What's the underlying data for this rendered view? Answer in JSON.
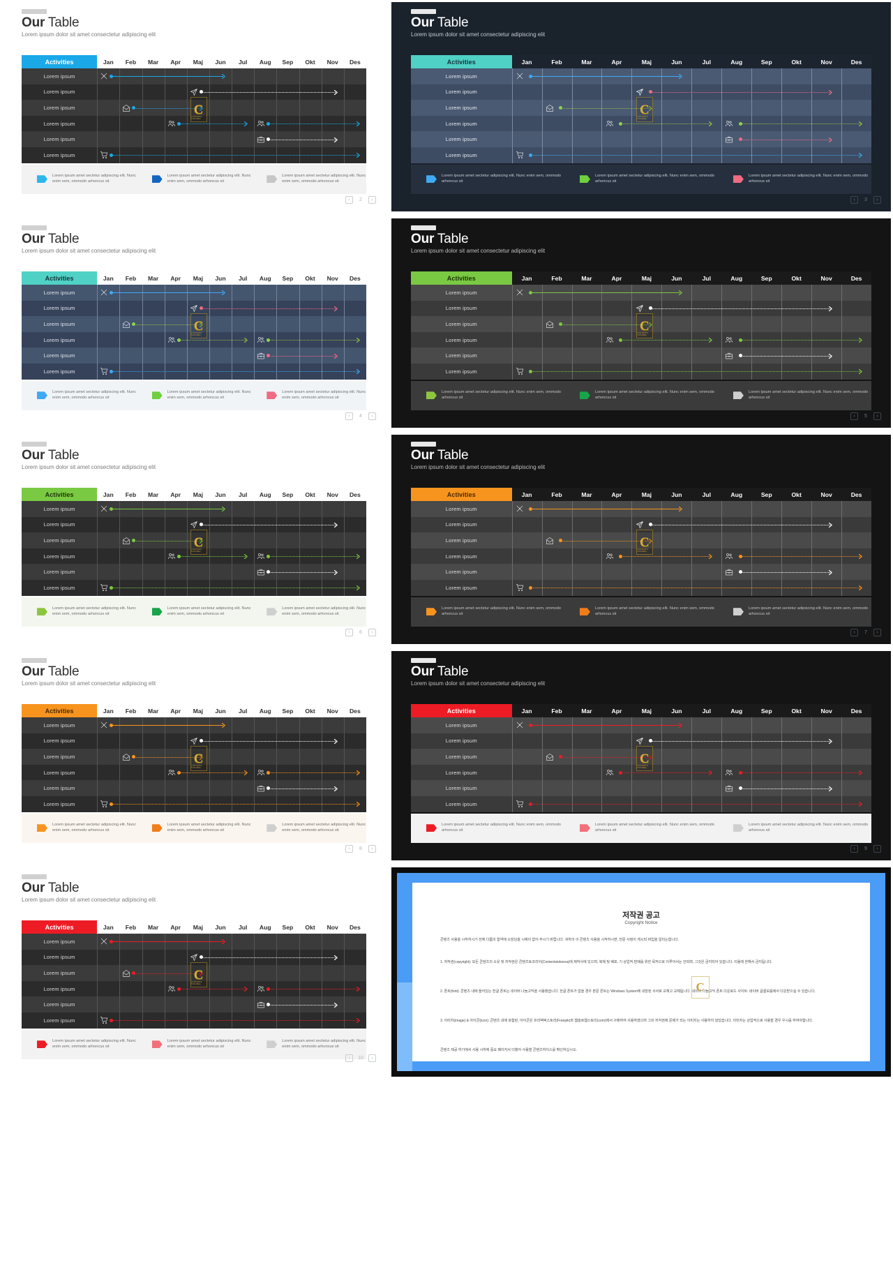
{
  "common": {
    "title_bold": "Our",
    "title_rest": " Table",
    "subtitle": "Lorem ipsum dolor sit amet consectetur adipiscing elit",
    "activities_header": "Activities",
    "months": [
      "Jan",
      "Feb",
      "Mar",
      "Apr",
      "Maj",
      "Jun",
      "Jul",
      "Aug",
      "Sep",
      "Okt",
      "Nov",
      "Des"
    ],
    "rows": [
      "Lorem ipsum",
      "Lorem ipsum",
      "Lorem ipsum",
      "Lorem ipsum",
      "Lorem ipsum",
      "Lorem ipsum"
    ],
    "row_icons": [
      "tools-icon",
      "paper-plane-icon",
      "mail-open-icon",
      "users-icon",
      "briefcase-icon",
      "shopping-cart-icon"
    ],
    "legend_text": "Lorem ipsum amet sectetur adipiscing elit. Nunc enim sem, ommodo arhoncus sit",
    "watermark_letter": "C",
    "watermark_sub": "CONTENTS TOKOREA",
    "pager_prev": "‹",
    "pager_next": "›"
  },
  "slides": [
    {
      "id": "slide-1-blue-light",
      "theme": "light",
      "page": "2",
      "accent": "#1aa8e8",
      "header_bg": "#1aa8e8",
      "header_text": "#ffffff",
      "title_color": "#333333",
      "subtitle_color": "#7b7b7b",
      "table_bg_odd": "#3b3b3b",
      "table_bg_even": "#2b2b2b",
      "grid_line": "#555555",
      "row_text": "#d6d6d6",
      "month_text": "#2e2e2e",
      "month_bg": "#ffffff",
      "legend_bg": "#f2f2f2",
      "legend_text_color": "#6d6d6d",
      "legend_pins": [
        "#2bb6ec",
        "#1565c0",
        "#c6c6c6"
      ],
      "bar_colors": [
        "#1aa8e8",
        "#ffffff",
        "#1aa8e8",
        "#1aa8e8",
        "#ffffff",
        "#1aa8e8"
      ],
      "dot_colors": [
        "#1aa8e8",
        "#ffffff",
        "#1aa8e8",
        "#1aa8e8",
        "#ffffff",
        "#1aa8e8"
      ],
      "tab_color": "#d0d0d0"
    },
    {
      "id": "slide-2-teal-navy",
      "theme": "dark",
      "page": "3",
      "accent": "#4fd1c5",
      "header_bg": "#4fd1c5",
      "header_text": "#17333a",
      "title_color": "#ffffff",
      "subtitle_color": "#c2c8d0",
      "table_bg_odd": "#4a5a73",
      "table_bg_even": "#3d4c63",
      "grid_line": "#7e8ca3",
      "row_text": "#e4e8ee",
      "month_text": "#ffffff",
      "month_bg": "#1c2430",
      "legend_bg": "#262f3d",
      "legend_text_color": "#c7cdd6",
      "legend_pins": [
        "#3fa9f5",
        "#6fcf3f",
        "#f06b82"
      ],
      "bar_colors": [
        "#3fa9f5",
        "#f06b82",
        "#9bbf3f",
        "#9bbf3f",
        "#f06b82",
        "#3fa9f5"
      ],
      "dot_colors": [
        "#3fa9f5",
        "#f06b82",
        "#8fd14f",
        "#8fd14f",
        "#f06b82",
        "#3fa9f5"
      ],
      "slide_bg": "#1a222c",
      "tab_color": "#e8e8e8"
    },
    {
      "id": "slide-3-teal-light",
      "theme": "light",
      "page": "4",
      "accent": "#4fd1c5",
      "header_bg": "#4fd1c5",
      "header_text": "#17333a",
      "title_color": "#333333",
      "subtitle_color": "#7b7b7b",
      "table_bg_odd": "#44556e",
      "table_bg_even": "#35425a",
      "grid_line": "#77849b",
      "row_text": "#dfe4ea",
      "month_text": "#2e2e2e",
      "month_bg": "#ffffff",
      "legend_bg": "#f1f4f7",
      "legend_text_color": "#6d6d6d",
      "legend_pins": [
        "#3fa9f5",
        "#6fcf3f",
        "#f06b82"
      ],
      "bar_colors": [
        "#3fa9f5",
        "#f06b82",
        "#9bbf3f",
        "#9bbf3f",
        "#f06b82",
        "#3fa9f5"
      ],
      "dot_colors": [
        "#3fa9f5",
        "#f06b82",
        "#8fd14f",
        "#8fd14f",
        "#f06b82",
        "#3fa9f5"
      ],
      "tab_color": "#d0d0d0"
    },
    {
      "id": "slide-4-green-dark",
      "theme": "dark",
      "page": "5",
      "accent": "#7ac943",
      "header_bg": "#7ac943",
      "header_text": "#1d3209",
      "title_color": "#ffffff",
      "subtitle_color": "#bdbdbd",
      "table_bg_odd": "#4a4a4a",
      "table_bg_even": "#3a3a3a",
      "grid_line": "#6e6e6e",
      "row_text": "#dcdcdc",
      "month_text": "#ffffff",
      "month_bg": "#1a1a1a",
      "legend_bg": "#3b3b3b",
      "legend_text_color": "#c4c4c4",
      "legend_pins": [
        "#8cc63f",
        "#19a44a",
        "#cfcfcf"
      ],
      "bar_colors": [
        "#7ac943",
        "#ffffff",
        "#7ac943",
        "#7ac943",
        "#ffffff",
        "#7ac943"
      ],
      "dot_colors": [
        "#7ac943",
        "#ffffff",
        "#7ac943",
        "#7ac943",
        "#ffffff",
        "#7ac943"
      ],
      "slide_bg": "#141414",
      "tab_color": "#e8e8e8"
    },
    {
      "id": "slide-5-green-light",
      "theme": "light",
      "page": "6",
      "accent": "#7ac943",
      "header_bg": "#7ac943",
      "header_text": "#1d3209",
      "title_color": "#333333",
      "subtitle_color": "#7b7b7b",
      "table_bg_odd": "#3b3b3b",
      "table_bg_even": "#2b2b2b",
      "grid_line": "#555555",
      "row_text": "#d6d6d6",
      "month_text": "#2e2e2e",
      "month_bg": "#ffffff",
      "legend_bg": "#f2f6ef",
      "legend_text_color": "#6d6d6d",
      "legend_pins": [
        "#8cc63f",
        "#19a44a",
        "#cfcfcf"
      ],
      "bar_colors": [
        "#7ac943",
        "#ffffff",
        "#7ac943",
        "#7ac943",
        "#ffffff",
        "#7ac943"
      ],
      "dot_colors": [
        "#7ac943",
        "#ffffff",
        "#7ac943",
        "#7ac943",
        "#ffffff",
        "#7ac943"
      ],
      "tab_color": "#d0d0d0"
    },
    {
      "id": "slide-6-orange-dark",
      "theme": "dark",
      "page": "7",
      "accent": "#f7941e",
      "header_bg": "#f7941e",
      "header_text": "#4a2a00",
      "title_color": "#ffffff",
      "subtitle_color": "#bdbdbd",
      "table_bg_odd": "#4a4a4a",
      "table_bg_even": "#3a3a3a",
      "grid_line": "#6e6e6e",
      "row_text": "#dcdcdc",
      "month_text": "#ffffff",
      "month_bg": "#1a1a1a",
      "legend_bg": "#3b3b3b",
      "legend_text_color": "#c4c4c4",
      "legend_pins": [
        "#f7941e",
        "#ef7d1a",
        "#cfcfcf"
      ],
      "bar_colors": [
        "#f7941e",
        "#ffffff",
        "#f7941e",
        "#f7941e",
        "#ffffff",
        "#f7941e"
      ],
      "dot_colors": [
        "#f7941e",
        "#ffffff",
        "#f7941e",
        "#f7941e",
        "#ffffff",
        "#f7941e"
      ],
      "slide_bg": "#141414",
      "tab_color": "#e8e8e8"
    },
    {
      "id": "slide-7-orange-light",
      "theme": "light",
      "page": "8",
      "accent": "#f7941e",
      "header_bg": "#f7941e",
      "header_text": "#4a2a00",
      "title_color": "#333333",
      "subtitle_color": "#7b7b7b",
      "table_bg_odd": "#3b3b3b",
      "table_bg_even": "#2b2b2b",
      "grid_line": "#555555",
      "row_text": "#d6d6d6",
      "month_text": "#2e2e2e",
      "month_bg": "#ffffff",
      "legend_bg": "#faf6ef",
      "legend_text_color": "#6d6d6d",
      "legend_pins": [
        "#f7941e",
        "#ef7d1a",
        "#cfcfcf"
      ],
      "bar_colors": [
        "#f7941e",
        "#ffffff",
        "#f7941e",
        "#f7941e",
        "#ffffff",
        "#f7941e"
      ],
      "dot_colors": [
        "#f7941e",
        "#ffffff",
        "#f7941e",
        "#f7941e",
        "#ffffff",
        "#f7941e"
      ],
      "tab_color": "#d0d0d0"
    },
    {
      "id": "slide-8-red-dark",
      "theme": "dark",
      "page": "9",
      "accent": "#ed1c24",
      "header_bg": "#ed1c24",
      "header_text": "#ffffff",
      "title_color": "#ffffff",
      "subtitle_color": "#bdbdbd",
      "table_bg_odd": "#4a4a4a",
      "table_bg_even": "#3a3a3a",
      "grid_line": "#6e6e6e",
      "row_text": "#dcdcdc",
      "month_text": "#ffffff",
      "month_bg": "#1a1a1a",
      "legend_bg": "#f2f2f2",
      "legend_text_color": "#6d6d6d",
      "legend_pins": [
        "#ed1c24",
        "#f2707a",
        "#cfcfcf"
      ],
      "bar_colors": [
        "#ed1c24",
        "#ffffff",
        "#ed1c24",
        "#ed1c24",
        "#ffffff",
        "#ed1c24"
      ],
      "dot_colors": [
        "#ed1c24",
        "#ffffff",
        "#ed1c24",
        "#ed1c24",
        "#ffffff",
        "#ed1c24"
      ],
      "slide_bg": "#141414",
      "tab_color": "#e8e8e8"
    },
    {
      "id": "slide-9-red-light",
      "theme": "light",
      "page": "10",
      "accent": "#ed1c24",
      "header_bg": "#ed1c24",
      "header_text": "#ffffff",
      "title_color": "#333333",
      "subtitle_color": "#7b7b7b",
      "table_bg_odd": "#3b3b3b",
      "table_bg_even": "#2b2b2b",
      "grid_line": "#555555",
      "row_text": "#d6d6d6",
      "month_text": "#2e2e2e",
      "month_bg": "#ffffff",
      "legend_bg": "#f2f2f2",
      "legend_text_color": "#6d6d6d",
      "legend_pins": [
        "#ed1c24",
        "#f2707a",
        "#cfcfcf"
      ],
      "bar_colors": [
        "#ed1c24",
        "#ffffff",
        "#ed1c24",
        "#ed1c24",
        "#ffffff",
        "#ed1c24"
      ],
      "dot_colors": [
        "#ed1c24",
        "#ffffff",
        "#ed1c24",
        "#ed1c24",
        "#ffffff",
        "#ed1c24"
      ],
      "tab_color": "#d0d0d0"
    }
  ],
  "gantt": [
    {
      "icon_col": 0,
      "start": 0,
      "end": 5,
      "style": "solid"
    },
    {
      "icon_col": 4,
      "start": 4,
      "end": 10,
      "style": "dotted"
    },
    {
      "icon_col": 1,
      "start": 1,
      "end": 4,
      "style": "dotted"
    },
    {
      "icon_col": 3,
      "start": 3,
      "end": 6,
      "style": "dotted",
      "second": {
        "icon_col": 7,
        "start": 7,
        "end": 11,
        "style": "dotted"
      }
    },
    {
      "icon_col": 7,
      "start": 7,
      "end": 10,
      "style": "dotted"
    },
    {
      "icon_col": 0,
      "start": 0,
      "end": 11,
      "style": "dotted"
    }
  ],
  "copyright": {
    "id": "copyright-slide",
    "frame_color": "#4a9cf6",
    "frame_color_2": "#7fbcfb",
    "title_ko": "저작권 공고",
    "title_en": "Copyright Notice",
    "intro": "콘텐츠 사용을 시작하시기 전에 다름의 합약에 소장님을 시예이 없어 주시기 바랍니다. 귀하의 이 콘텐츠 사용을 시작하시면, 전문 사정이 게시되 바입을 알리는합니다.",
    "item1": "1. 저작권(copyright): 모든 콘텐츠의 소유 및 저작권은 콘텐츠토코리아(Contentstokorea)에 제작사에 있으며, 복제 및 배포, 기 상업적 판매를 위한 목적으로 이루어서는 안되며, 그것은 금지되어 있습니다. 이용에 한해서 금지됩니다.",
    "item2": "2. 폰트(font): 콘텐츠 내에 들어있는 한글 폰트는 네이버 나눔고딕을 사용했습니다. 한글 폰트가 없을 경우 본문 폰트는 Windows System에 내장된 사서로 교체고 교체됩니다. 네이버 나눔고딕 폰트 다운로드 사이트: 네이버 글꼴모음에서 다운받으실 수 있습니다.",
    "item3": "3. 이미지(image) & 아이콘(icon): 콘텐츠 내에 포함된, 아이콘은 프리벡픽스토리(Freepik)와 웹슬로웹스토리(com)에서 구매하여 사용하였으며 그외 저작권에 문제가 되는 이미지는 사용하지 않았습니다. 이미지는 상업적으로 사용할 경우 우시를 하여야합니다.",
    "outro": "콘텐츠 제공 하기에서 사용 시하에 중요 페이지서 더했어 사용할 콘텐츠하이스를 확인하십시오.",
    "watermark_letter": "C"
  }
}
